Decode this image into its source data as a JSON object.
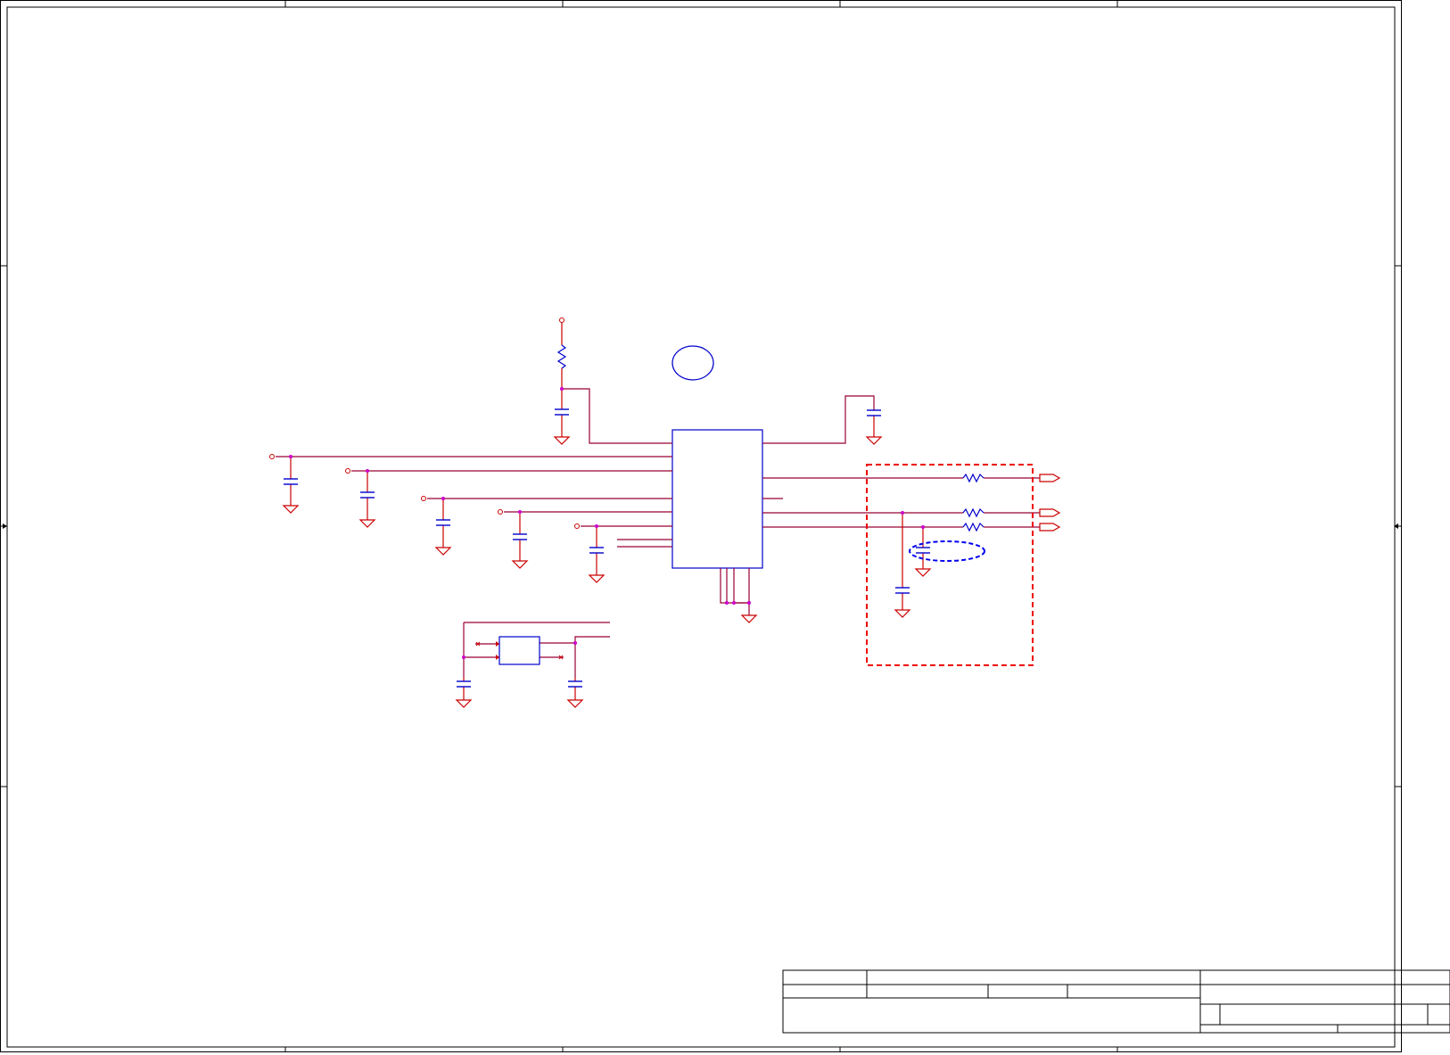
{
  "sheet": {
    "title": "",
    "colors": {
      "frame": "#000000",
      "wire": "#cc0000",
      "net": "#990033",
      "component": "#0000cc",
      "junction": "#cc00cc",
      "highlight_box": "#ee0000",
      "highlight_ellipse": "#0000ee"
    }
  },
  "title_block": {
    "company": "",
    "title": "",
    "size": "",
    "document_number": "",
    "rev": "",
    "date": "",
    "sheet": ""
  }
}
